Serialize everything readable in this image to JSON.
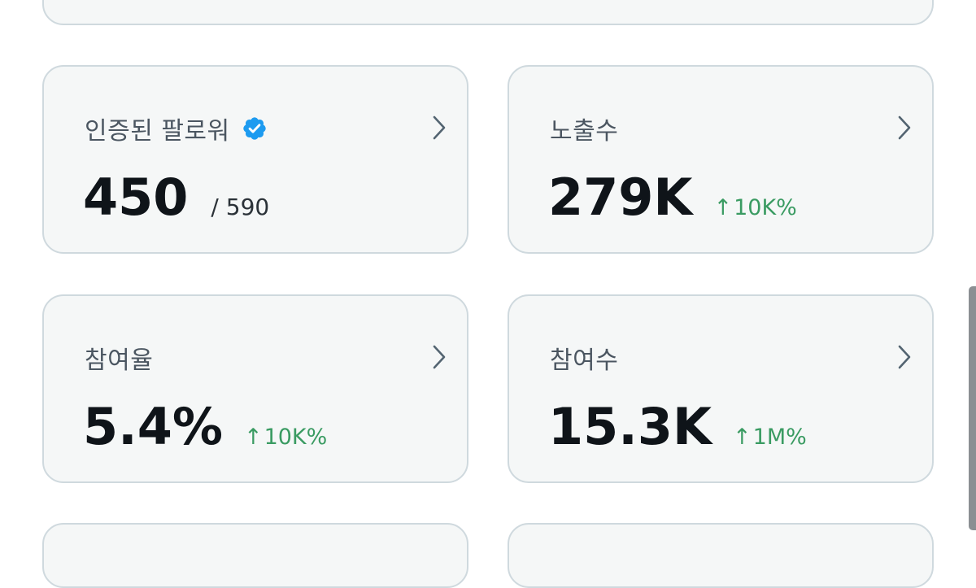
{
  "cards": [
    {
      "label": "인증된 팔로워",
      "value": "450",
      "sub": "/ 590",
      "verified": true,
      "icon": "verified-badge-icon"
    },
    {
      "label": "노출수",
      "value": "279K",
      "delta": "10K%",
      "arrow": "↑"
    },
    {
      "label": "참여율",
      "value": "5.4%",
      "delta": "10K%",
      "arrow": "↑"
    },
    {
      "label": "참여수",
      "value": "15.3K",
      "delta": "1M%",
      "arrow": "↑"
    }
  ],
  "colors": {
    "card_bg": "#f5f7f7",
    "card_border": "#cfd9de",
    "delta_green": "#3a9b62",
    "verified_blue": "#1d9bf0",
    "chevron": "#536471"
  }
}
